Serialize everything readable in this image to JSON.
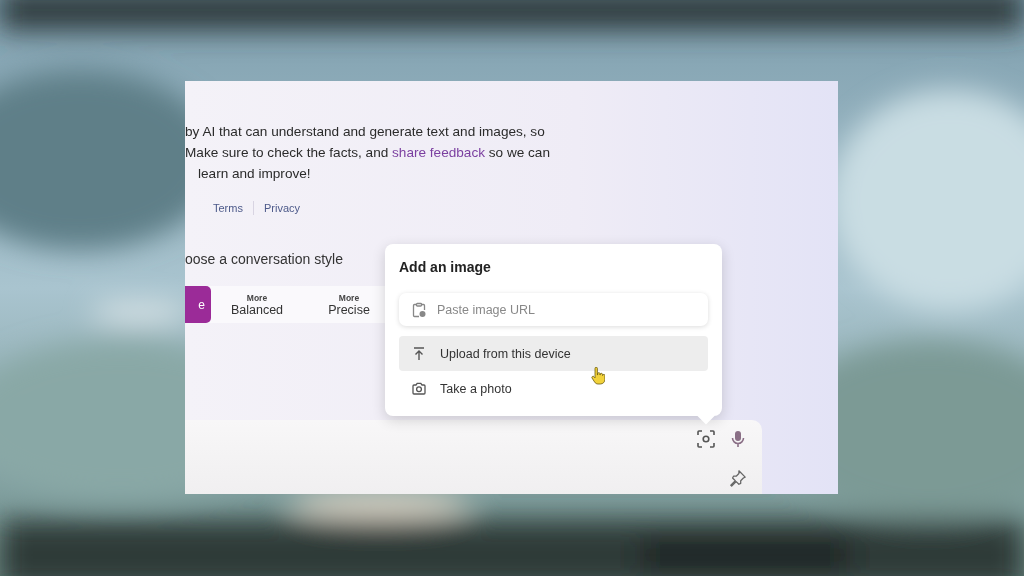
{
  "disclaimer": {
    "line_1": "by AI that can understand and generate text and images, so",
    "line_2_start": "Make sure to check the facts, and",
    "link": "share feedback",
    "line_2_end": "so we can",
    "line_3": "learn and improve!"
  },
  "footer_links": [
    "Terms",
    "Privacy"
  ],
  "style_heading": "oose a conversation style",
  "styles": [
    {
      "label": "e",
      "selected": true
    },
    {
      "prefix": "More",
      "label": "Balanced",
      "selected": false
    },
    {
      "prefix": "More",
      "label": "Precise",
      "selected": false
    }
  ],
  "image_popup": {
    "title": "Add an image",
    "url_field": {
      "placeholder": "Paste image URL"
    },
    "options": [
      {
        "kind": "upload",
        "label": "Upload from this device",
        "highlighted": true
      },
      {
        "kind": "camera",
        "label": "Take a photo",
        "highlighted": false
      }
    ]
  }
}
